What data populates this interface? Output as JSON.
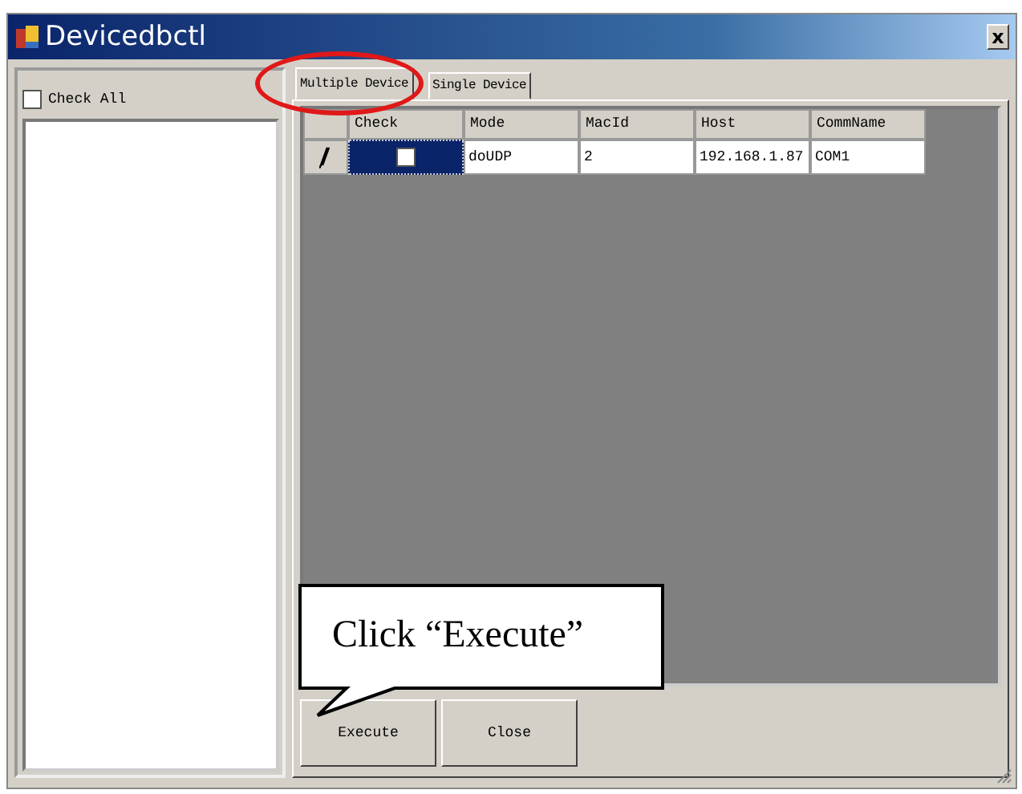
{
  "window": {
    "title": "Devicedbctl",
    "close": "x"
  },
  "check_all": {
    "label": "Check All",
    "checked": false
  },
  "tabs": [
    {
      "label": "Multiple Device",
      "selected": true
    },
    {
      "label": "Single Device",
      "selected": false
    }
  ],
  "grid": {
    "columns": [
      "Check",
      "Mode",
      "MacId",
      "Host",
      "CommName"
    ],
    "rows": [
      {
        "editing": true,
        "checked": false,
        "selected": true,
        "mode": "doUDP",
        "mac_id": "2",
        "host": "192.168.1.87",
        "comm_name": "COM1"
      }
    ]
  },
  "buttons": [
    "Execute",
    "Close"
  ],
  "callout": {
    "text": "Click “Execute”"
  }
}
